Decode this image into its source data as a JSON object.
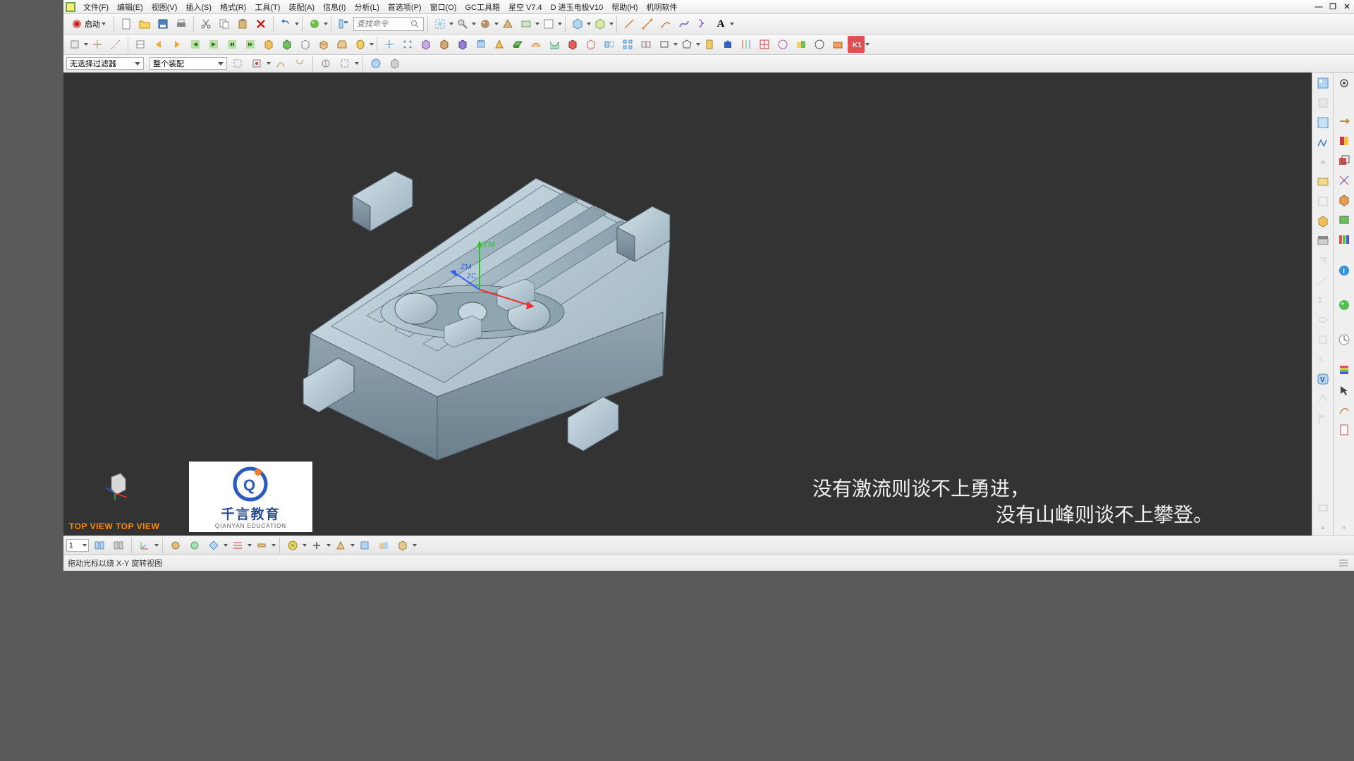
{
  "menubar": {
    "items": [
      "文件(F)",
      "编辑(E)",
      "视图(V)",
      "插入(S)",
      "格式(R)",
      "工具(T)",
      "装配(A)",
      "信息(I)",
      "分析(L)",
      "首选项(P)",
      "窗口(O)",
      "GC工具箱",
      "星空 V7.4",
      "D 进玉电极V10",
      "帮助(H)",
      "机明软件"
    ]
  },
  "toolbar1": {
    "start": "启动",
    "search_placeholder": "查找命令"
  },
  "filterbar": {
    "combo1": "无选择过滤器",
    "combo2": "整个装配"
  },
  "viewport": {
    "view_label": "TOP VIEW   TOP VIEW",
    "axes": {
      "y": "YM",
      "z": "ZM",
      "zc": "ZC"
    }
  },
  "watermark": {
    "title": "千言教育",
    "subtitle": "QIANYAN EDUCATION"
  },
  "caption": {
    "line1": "没有激流则谈不上勇进，",
    "line2": "没有山峰则谈不上攀登。"
  },
  "bottombar": {
    "layer": "1"
  },
  "statusbar": {
    "message": "拖动光标以绕 X-Y 旋转视图"
  }
}
